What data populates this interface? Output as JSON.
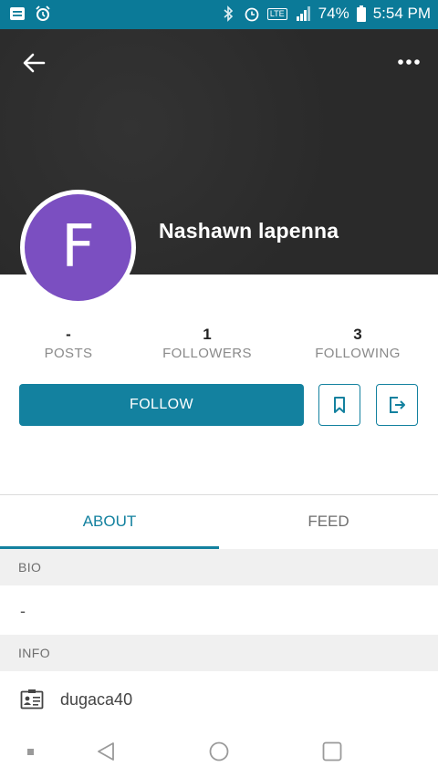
{
  "status_bar": {
    "battery": "74%",
    "time": "5:54 PM",
    "network_badge": "LTE",
    "icons": [
      "notification-icon",
      "alarm-clock-icon",
      "bluetooth-icon",
      "alarm-icon",
      "hd-icon",
      "signal-icon",
      "battery-icon"
    ]
  },
  "header": {
    "back_icon": "back-arrow-icon",
    "more_icon": "more-options-icon",
    "name": "Nashawn lapenna",
    "avatar_letter": "F",
    "avatar_color": "#7b4fc1"
  },
  "stats": [
    {
      "value": "-",
      "label": "POSTS"
    },
    {
      "value": "1",
      "label": "FOLLOWERS"
    },
    {
      "value": "3",
      "label": "FOLLOWING"
    }
  ],
  "actions": {
    "follow_label": "FOLLOW",
    "bookmark_icon": "bookmark-icon",
    "exit_icon": "exit-icon",
    "accent": "#13819f"
  },
  "tabs": [
    {
      "label": "ABOUT",
      "active": true
    },
    {
      "label": "FEED",
      "active": false
    }
  ],
  "about": {
    "bio_header": "BIO",
    "bio_text": "-",
    "info_header": "INFO",
    "info_items": [
      {
        "icon": "id-card-icon",
        "text": "dugaca40"
      }
    ]
  },
  "nav_bar": {
    "buttons": [
      "recent-dot-icon",
      "back-triangle-icon",
      "home-circle-icon",
      "overview-square-icon"
    ]
  }
}
